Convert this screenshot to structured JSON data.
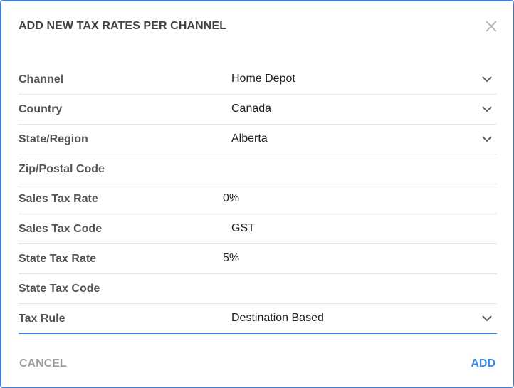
{
  "dialog": {
    "title": "ADD NEW TAX RATES PER CHANNEL",
    "close_icon": "close-icon"
  },
  "fields": [
    {
      "label": "Channel",
      "value": "Home Depot",
      "type": "select"
    },
    {
      "label": "Country",
      "value": "Canada",
      "type": "select"
    },
    {
      "label": "State/Region",
      "value": "Alberta",
      "type": "select"
    },
    {
      "label": "Zip/Postal Code",
      "value": "",
      "type": "text"
    },
    {
      "label": "Sales Tax Rate",
      "value": "0%",
      "type": "text"
    },
    {
      "label": "Sales Tax Code",
      "value": "GST",
      "type": "text"
    },
    {
      "label": "State Tax Rate",
      "value": "5%",
      "type": "text"
    },
    {
      "label": "State Tax Code",
      "value": "",
      "type": "text"
    },
    {
      "label": "Tax Rule",
      "value": "Destination Based",
      "type": "select"
    }
  ],
  "actions": {
    "cancel_label": "CANCEL",
    "add_label": "ADD"
  },
  "colors": {
    "accent": "#3d8be0",
    "border": "#3d7fd6",
    "label": "#555555",
    "muted": "#9e9e9e"
  }
}
